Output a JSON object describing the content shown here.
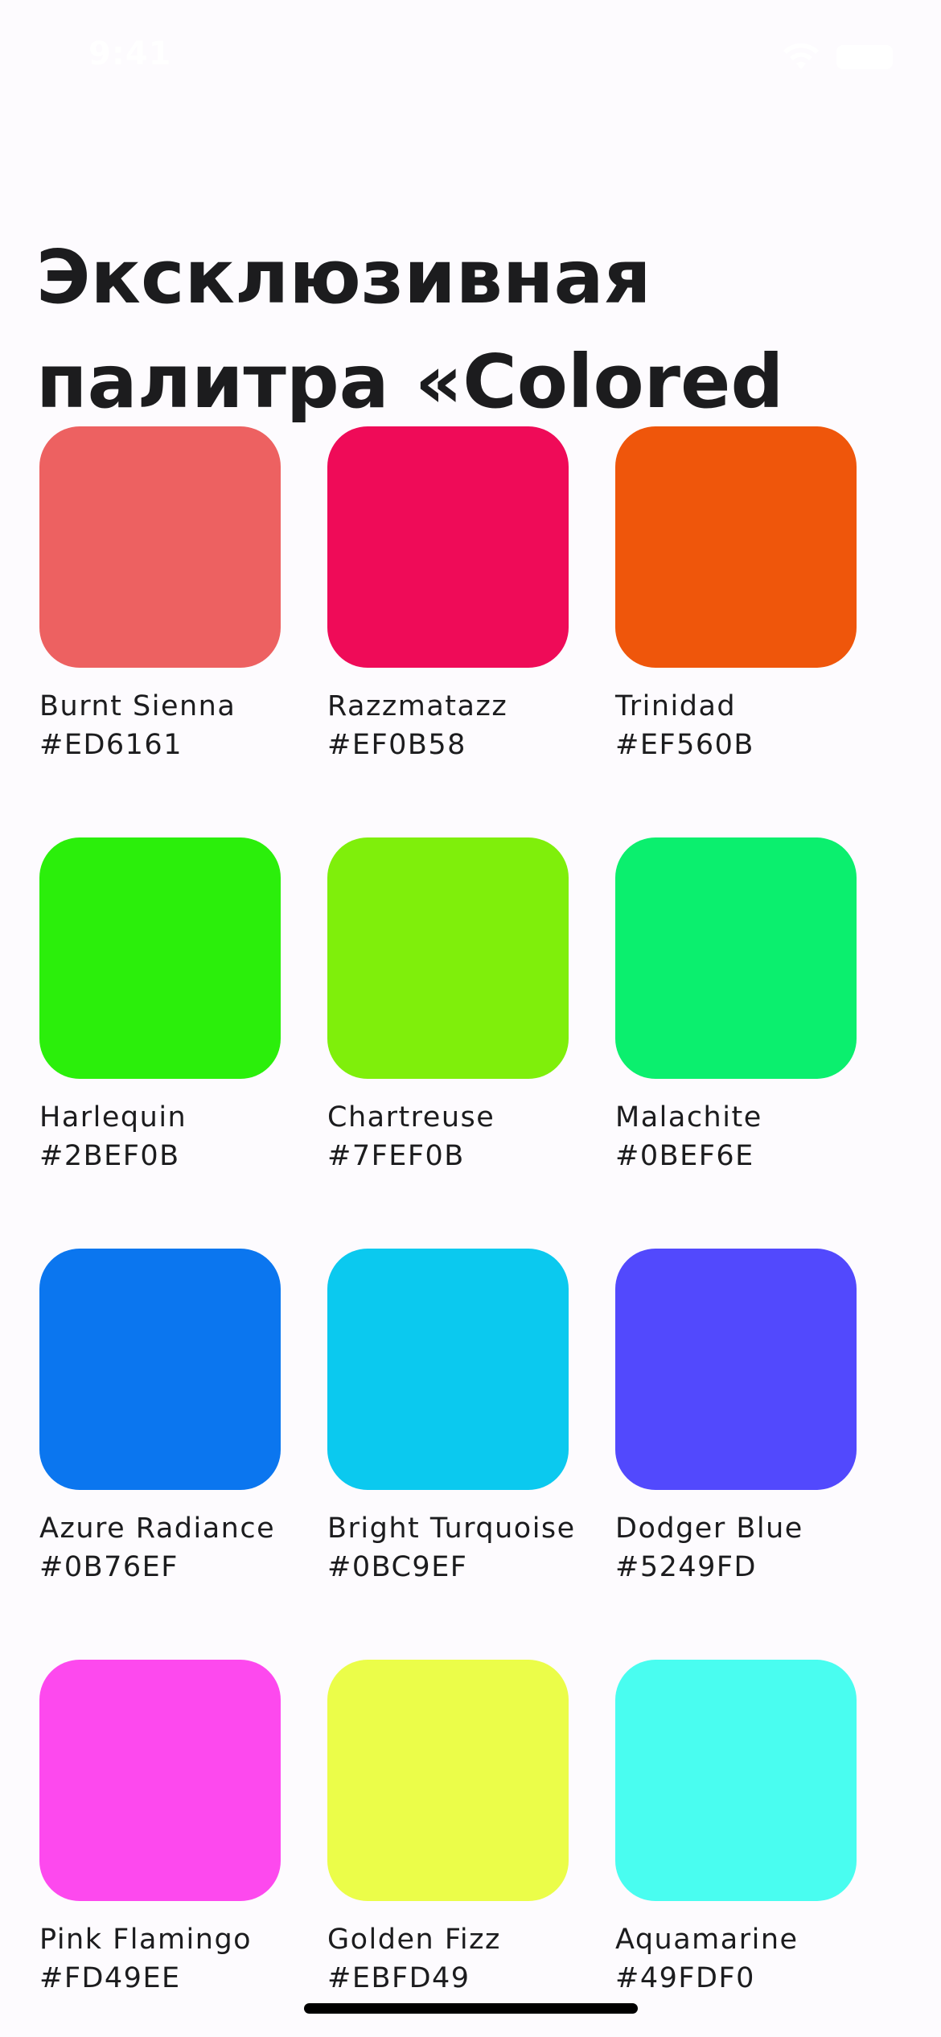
{
  "status_bar": {
    "time": "9:41",
    "wifi_icon": "wifi-icon",
    "battery_icon": "battery-icon"
  },
  "header": {
    "title": "Эксклюзивная палитра «Colored Box»"
  },
  "colors": [
    {
      "name": "Burnt Sienna",
      "hex": "#ED6161"
    },
    {
      "name": "Razzmatazz",
      "hex": "#EF0B58"
    },
    {
      "name": "Trinidad",
      "hex": "#EF560B"
    },
    {
      "name": "Harlequin",
      "hex": "#2BEF0B"
    },
    {
      "name": "Chartreuse",
      "hex": "#7FEF0B"
    },
    {
      "name": "Malachite",
      "hex": "#0BEF6E"
    },
    {
      "name": "Azure Radiance",
      "hex": "#0B76EF"
    },
    {
      "name": "Bright Turquoise",
      "hex": "#0BC9EF"
    },
    {
      "name": "Dodger Blue",
      "hex": "#5249FD"
    },
    {
      "name": "Pink Flamingo",
      "hex": "#FD49EE"
    },
    {
      "name": "Golden Fizz",
      "hex": "#EBFD49"
    },
    {
      "name": "Aquamarine",
      "hex": "#49FDF0"
    }
  ]
}
